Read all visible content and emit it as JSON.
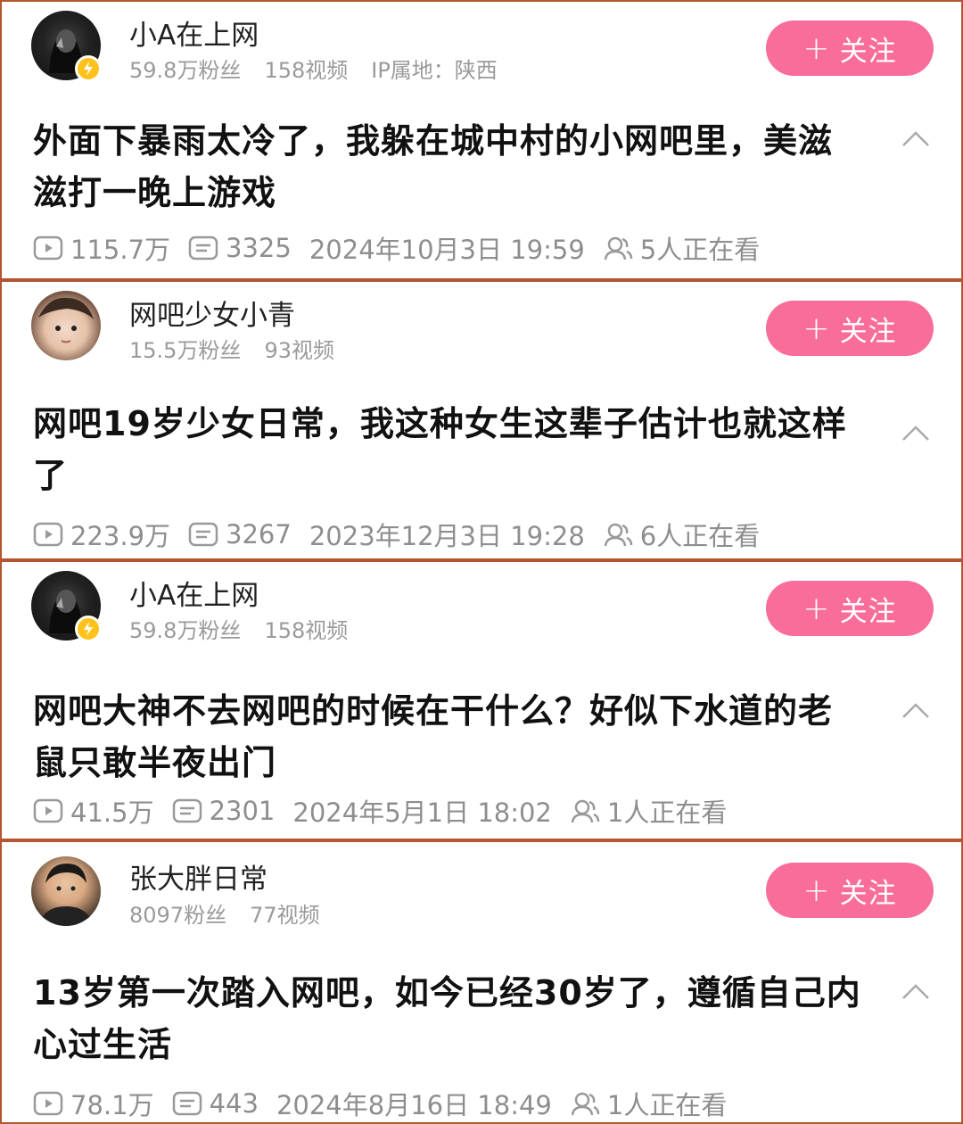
{
  "cards": [
    {
      "name": "小A在上网",
      "fans": "59.8万粉丝",
      "videos": "158视频",
      "ip": "IP属地：陕西",
      "follow_label": "关注",
      "title": "外面下暴雨太冷了，我躲在城中村的小网吧里，美滋滋打一晚上游戏",
      "plays": "115.7万",
      "comments": "3325",
      "date": "2024年10月3日 19:59",
      "watching": "5人正在看"
    },
    {
      "name": "网吧少女小青",
      "fans": "15.5万粉丝",
      "videos": "93视频",
      "follow_label": "关注",
      "title": "网吧19岁少女日常，我这种女生这辈子估计也就这样了",
      "plays": "223.9万",
      "comments": "3267",
      "date": "2023年12月3日 19:28",
      "watching": "6人正在看"
    },
    {
      "name": "小A在上网",
      "fans": "59.8万粉丝",
      "videos": "158视频",
      "follow_label": "关注",
      "title": "网吧大神不去网吧的时候在干什么？好似下水道的老鼠只敢半夜出门",
      "plays": "41.5万",
      "comments": "2301",
      "date": "2024年5月1日 18:02",
      "watching": "1人正在看"
    },
    {
      "name": "张大胖日常",
      "fans": "8097粉丝",
      "videos": "77视频",
      "follow_label": "关注",
      "title": "13岁第一次踏入网吧，如今已经30岁了，遵循自己内心过生活",
      "plays": "78.1万",
      "comments": "443",
      "date": "2024年8月16日 18:49",
      "watching": "1人正在看"
    }
  ],
  "colors": {
    "border": "#b5552f",
    "follow_button": "#f86d99",
    "badge": "#ffc21a",
    "secondary_text": "#9a9a9a"
  },
  "icons": [
    "play-icon",
    "danmaku-icon",
    "viewers-icon",
    "chevron-up-icon",
    "verified-badge-icon",
    "plus-icon"
  ]
}
